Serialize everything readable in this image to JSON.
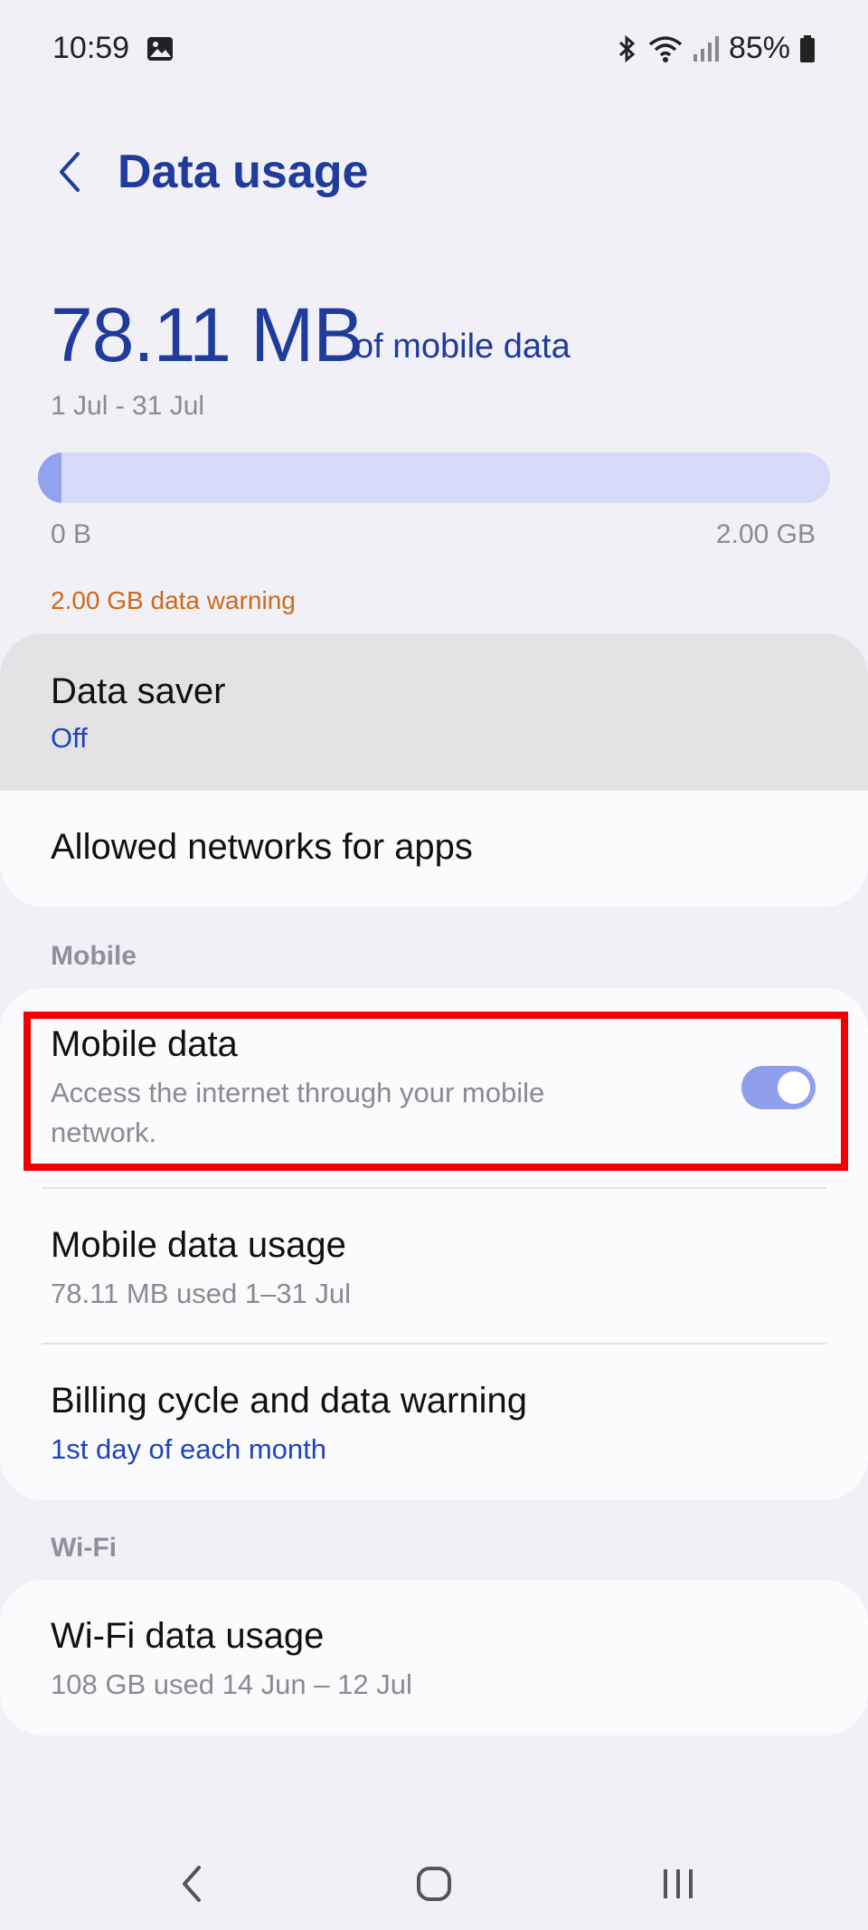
{
  "status_bar": {
    "time": "10:59",
    "battery": "85%"
  },
  "header": {
    "title": "Data usage",
    "back_icon": "chevron-left-icon"
  },
  "usage": {
    "amount": "78.11 MB",
    "suffix": "of mobile data",
    "period": "1 Jul - 31 Jul",
    "progress_fraction": 0.03,
    "min_label": "0 B",
    "max_label": "2.00 GB",
    "warning": "2.00 GB data warning"
  },
  "card1": {
    "data_saver": {
      "title": "Data saver",
      "value": "Off"
    },
    "allowed_networks": {
      "title": "Allowed networks for apps"
    }
  },
  "mobile_section": {
    "label": "Mobile",
    "mobile_data": {
      "title": "Mobile data",
      "subtitle_line1": "Access the internet through your mobile",
      "subtitle_line2": "network.",
      "enabled": true
    },
    "mobile_data_usage": {
      "title": "Mobile data usage",
      "subtitle": "78.11 MB used 1–31 Jul"
    },
    "billing_cycle": {
      "title": "Billing cycle and data warning",
      "subtitle": "1st day of each month"
    }
  },
  "wifi_section": {
    "label": "Wi-Fi",
    "wifi_data_usage": {
      "title": "Wi-Fi data usage",
      "subtitle": "108 GB used 14 Jun – 12 Jul"
    }
  },
  "colors": {
    "accent": "#1f3b9c",
    "warning": "#cc6a1a",
    "toggle_on": "#8f9fec",
    "highlight": "#ee0000"
  }
}
